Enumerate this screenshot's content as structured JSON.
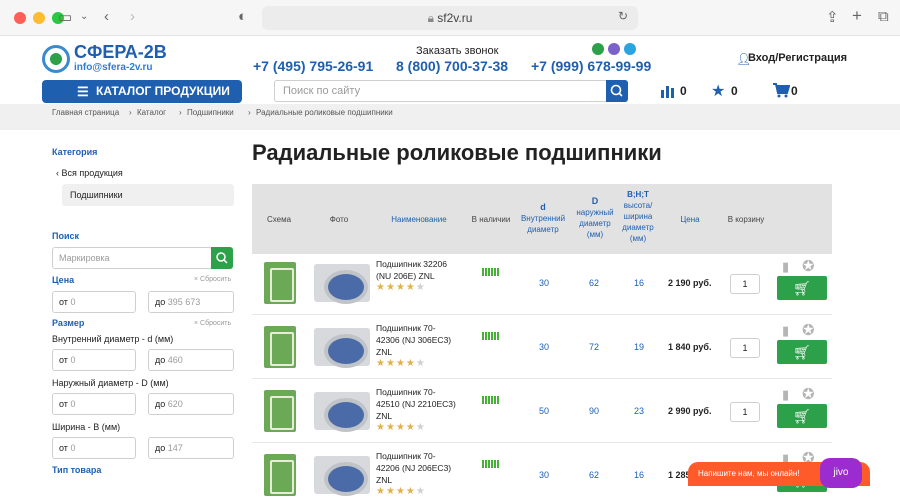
{
  "browser": {
    "url": "sf2v.ru"
  },
  "header": {
    "logo_title": "СФЕРА-2В",
    "logo_email": "info@sfera-2v.ru",
    "phone1": "+7 (495) 795-26-91",
    "callback_label": "Заказать звонок",
    "phone2": "8 (800) 700-37-38",
    "phone3": "+7 (999) 678-99-99",
    "login_label": "Вход/Регистрация",
    "catalog_button": "КАТАЛОГ ПРОДУКЦИИ",
    "search_placeholder": "Поиск по сайту",
    "compare_count": "0",
    "favorites_count": "0",
    "cart_count": "0"
  },
  "breadcrumbs": [
    "Главная страница",
    "Каталог",
    "Подшипники",
    "Радиальные роликовые подшипники"
  ],
  "sidebar": {
    "category_title": "Категория",
    "all_products": "Вся продукция",
    "selected_category": "Подшипники",
    "search_title": "Поиск",
    "search_placeholder": "Маркировка",
    "price_title": "Цена",
    "reset_label": "Сбросить",
    "from_label": "от",
    "to_label": "до",
    "price_from": "0",
    "price_to": "395 673",
    "size_title": "Размер",
    "inner_diameter_label": "Внутренний диаметр - d (мм)",
    "inner_from": "0",
    "inner_to": "460",
    "outer_diameter_label": "Наружный диаметр - D (мм)",
    "outer_from": "0",
    "outer_to": "620",
    "width_label": "Ширина - B (мм)",
    "width_from": "0",
    "width_to": "147",
    "type_title": "Тип товара"
  },
  "page_title": "Радиальные роликовые подшипники",
  "table": {
    "headers": {
      "scheme": "Схема",
      "photo": "Фото",
      "name": "Наименование",
      "stock": "В наличии",
      "d_symbol": "d",
      "d_text": [
        "Внутренний",
        "диаметр"
      ],
      "D_symbol": "D",
      "D_text": [
        "наружный",
        "диаметр",
        "(мм)"
      ],
      "BHT_symbol": "B;H;T",
      "BHT_text": [
        "высота/",
        "ширина",
        "диаметр",
        "(мм)"
      ],
      "price": "Цена",
      "cart": "В корзину"
    },
    "rows": [
      {
        "name_lines": [
          "Подшипник 32206",
          "(NU 206E) ZNL"
        ],
        "d": "30",
        "D": "62",
        "B": "16",
        "price": "2 190 руб.",
        "qty": "1",
        "rating": 4
      },
      {
        "name_lines": [
          "Подшипник 70-",
          "42306 (NJ 306EC3)",
          "ZNL"
        ],
        "d": "30",
        "D": "72",
        "B": "19",
        "price": "1 840 руб.",
        "qty": "1",
        "rating": 4
      },
      {
        "name_lines": [
          "Подшипник 70-",
          "42510 (NJ 2210EC3)",
          "ZNL"
        ],
        "d": "50",
        "D": "90",
        "B": "23",
        "price": "2 990 руб.",
        "qty": "1",
        "rating": 4
      },
      {
        "name_lines": [
          "Подшипник 70-",
          "42206 (NJ 206EC3)",
          "ZNL"
        ],
        "d": "30",
        "D": "62",
        "B": "16",
        "price": "1 285",
        "qty": "1",
        "rating": 4
      }
    ]
  },
  "chat": {
    "text": "Напишите нам, мы онлайн!",
    "brand": "jivo"
  },
  "colors": {
    "primary": "#1e5fb0",
    "green": "#2da04a",
    "chat": "#ff5a2a"
  }
}
